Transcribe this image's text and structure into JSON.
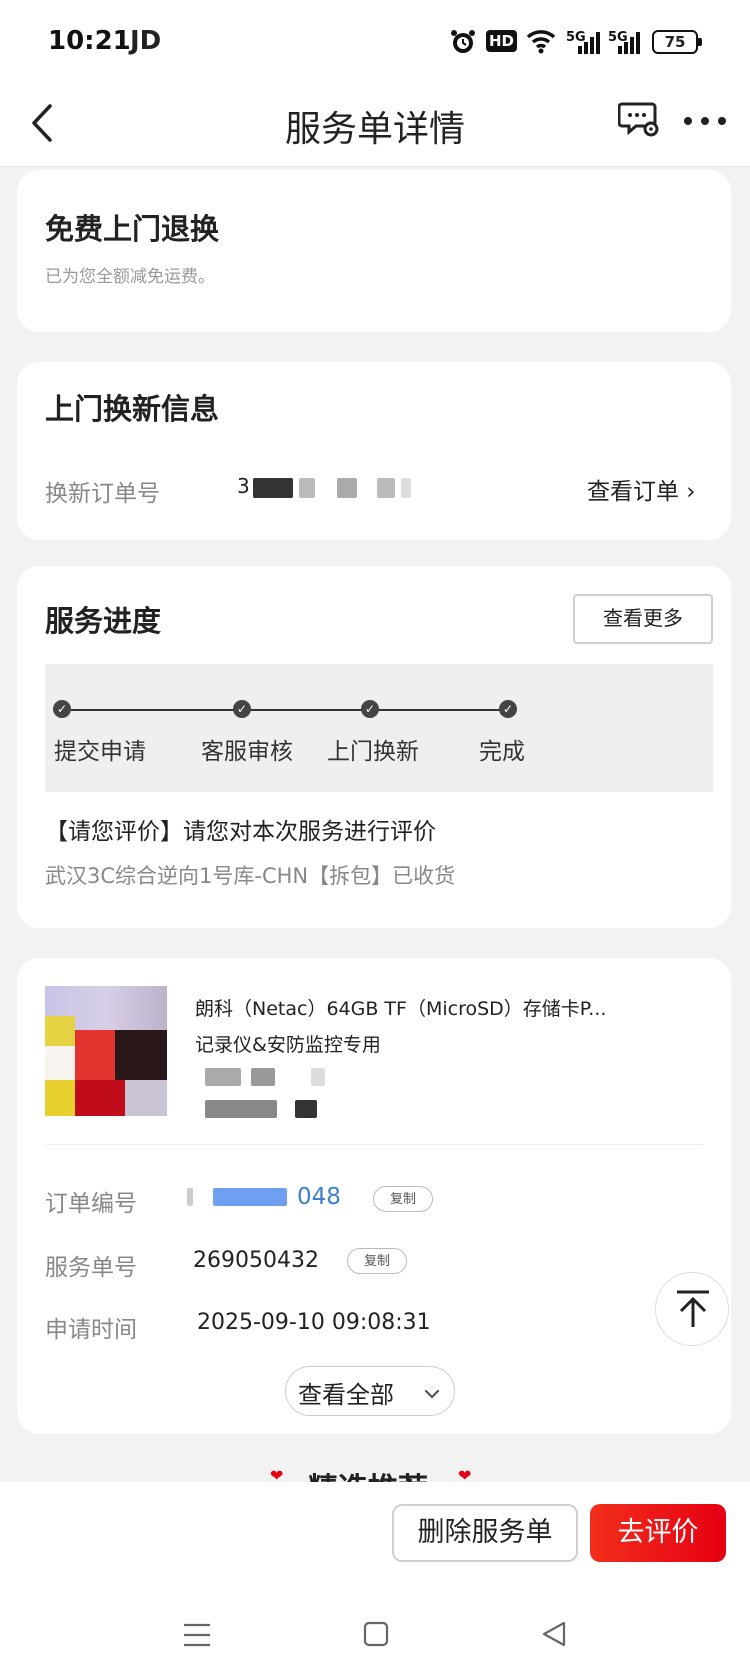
{
  "status_bar": {
    "time": "10:21",
    "carrier": "JD",
    "hd": "HD",
    "signal1": "5G",
    "signal2": "5G",
    "battery": "75"
  },
  "navbar": {
    "title": "服务单详情"
  },
  "free_return": {
    "title": "免费上门退换",
    "subtitle": "已为您全额减免运费。"
  },
  "exchange_info": {
    "title": "上门换新信息",
    "order_label": "换新订单号",
    "order_prefix": "3",
    "view_order": "查看订单 ›"
  },
  "progress": {
    "title": "服务进度",
    "more_button": "查看更多",
    "steps": [
      "提交申请",
      "客服审核",
      "上门换新",
      "完成"
    ],
    "message": "【请您评价】请您对本次服务进行评价",
    "location": "武汉3C综合逆向1号库-CHN【拆包】已收货"
  },
  "product": {
    "name": "朗科（Netac）64GB TF（MicroSD）存储卡P...",
    "desc": "记录仪&安防监控专用"
  },
  "details": {
    "order_no_label": "订单编号",
    "order_no_tail": "048",
    "copy": "复制",
    "service_no_label": "服务单号",
    "service_no": "269050432",
    "apply_time_label": "申请时间",
    "apply_time": "2025-09-10 09:08:31",
    "view_all": "查看全部"
  },
  "recommend": {
    "title": "精选推荐"
  },
  "bottom": {
    "delete_button": "删除服务单",
    "review_button": "去评价"
  },
  "colors": {
    "accent": "#e60012",
    "link": "#3b7fd0"
  }
}
